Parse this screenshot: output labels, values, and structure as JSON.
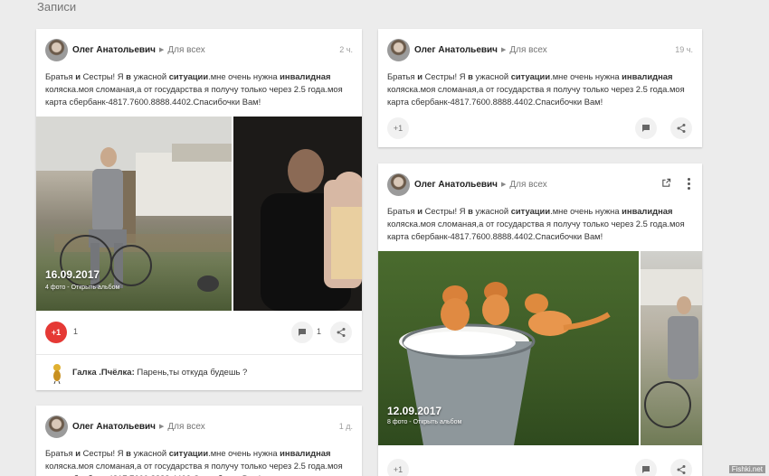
{
  "section_title": "Записи",
  "post_text_parts": {
    "p1": "Братья ",
    "b1": "и",
    "p2": " Сестры! Я ",
    "b2": "в",
    "p3": " ужасной ",
    "b3": "ситуации",
    "p4": ".мне очень нужна ",
    "b4": "инвалидная",
    "p5": " коляска.моя сломаная,а от государства я получу только через 2.5 года.моя карта сбербанк-4817.7600.8888.4402.Спасибочки Вам!"
  },
  "posts": [
    {
      "author": "Олег Анатольевич",
      "audience": "Для всех",
      "time": "2 ч.",
      "photo_date": "16.09.2017",
      "photo_album": "4 фото - Открыть альбом",
      "plus_label": "+1",
      "plus_count": "1",
      "comment_count": "1",
      "comment_author": "Галка .Пчёлка:",
      "comment_text": " Парень,ты откуда будешь ?"
    },
    {
      "author": "Олег Анатольевич",
      "audience": "Для всех",
      "time": "19 ч.",
      "plus_label": "+1"
    },
    {
      "author": "Олег Анатольевич",
      "audience": "Для всех",
      "photo_date": "12.09.2017",
      "photo_album": "8 фото - Открыть альбом",
      "plus_label": "+1"
    },
    {
      "author": "Олег Анатольевич",
      "audience": "Для всех",
      "time": "1 д."
    }
  ],
  "watermark": "Fishki.net",
  "colors": {
    "plus_active": "#e53935",
    "background": "#ececec"
  },
  "icons": [
    "comment-icon",
    "share-icon",
    "open-in-new-icon",
    "more-vert-icon"
  ]
}
